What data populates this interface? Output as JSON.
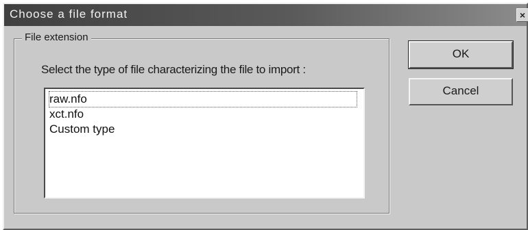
{
  "dialog": {
    "title": "Choose a file format",
    "close_glyph": "×"
  },
  "group": {
    "legend": "File extension",
    "instruction": "Select the type of file characterizing the file to import :"
  },
  "list": {
    "items": [
      {
        "label": "raw.nfo",
        "selected": true
      },
      {
        "label": "xct.nfo",
        "selected": false
      },
      {
        "label": "Custom type",
        "selected": false
      }
    ]
  },
  "buttons": {
    "ok_label": "OK",
    "cancel_label": "Cancel"
  }
}
